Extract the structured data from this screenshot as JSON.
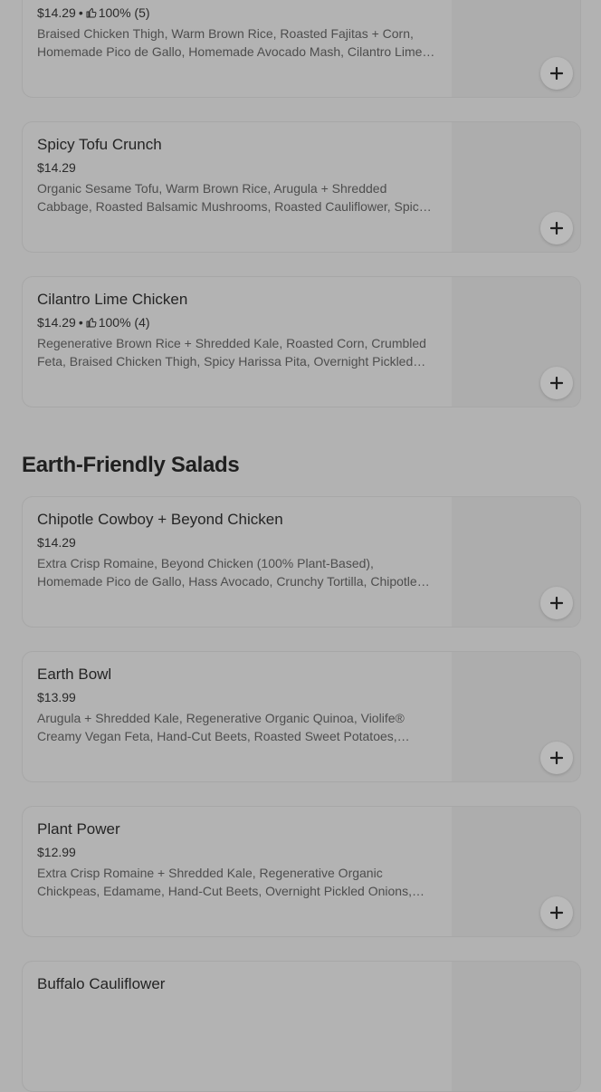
{
  "menu": {
    "bowls": [
      {
        "name": "",
        "price": "$14.29",
        "rating": "100% (5)",
        "description": "Braised Chicken Thigh, Warm Brown Rice, Roasted Fajitas + Corn, Homemade Pico de Gallo, Homemade Avocado Mash, Cilantro Lime Crema"
      },
      {
        "name": "Spicy Tofu Crunch",
        "price": "$14.29",
        "rating": "",
        "description": "Organic Sesame Tofu, Warm Brown Rice, Arugula + Shredded Cabbage, Roasted Balsamic Mushrooms, Roasted Cauliflower, Spicy Cashew Dressing"
      },
      {
        "name": "Cilantro Lime Chicken",
        "price": "$14.29",
        "rating": "100% (4)",
        "description": "Regenerative Brown Rice + Shredded Kale, Roasted Corn, Crumbled Feta, Braised Chicken Thigh, Spicy Harissa Pita, Overnight Pickled Onions"
      }
    ],
    "salads_section_title": "Earth-Friendly Salads",
    "salads": [
      {
        "name": "Chipotle Cowboy + Beyond Chicken",
        "price": "$14.29",
        "rating": "",
        "description": "Extra Crisp Romaine, Beyond Chicken (100% Plant-Based), Homemade Pico de Gallo, Hass Avocado, Crunchy Tortilla, Chipotle Ranch"
      },
      {
        "name": "Earth Bowl",
        "price": "$13.99",
        "rating": "",
        "description": "Arugula + Shredded Kale, Regenerative Organic Quinoa, Violife® Creamy Vegan Feta, Hand-Cut Beets, Roasted Sweet Potatoes, Green Goddess"
      },
      {
        "name": "Plant Power",
        "price": "$12.99",
        "rating": "",
        "description": "Extra Crisp Romaine + Shredded Kale, Regenerative Organic Chickpeas, Edamame, Hand-Cut Beets, Overnight Pickled Onions, Tahini Dressing"
      },
      {
        "name": "Buffalo Cauliflower",
        "price": "",
        "rating": "",
        "description": ""
      }
    ]
  },
  "icons": {
    "add": "plus-icon",
    "rating": "thumbs-up-icon"
  },
  "colors": {
    "overlay_background": "#b2b2b2",
    "card_border": "#a7a7a7",
    "title_text": "#242424",
    "description_text": "#4d4d4d"
  }
}
